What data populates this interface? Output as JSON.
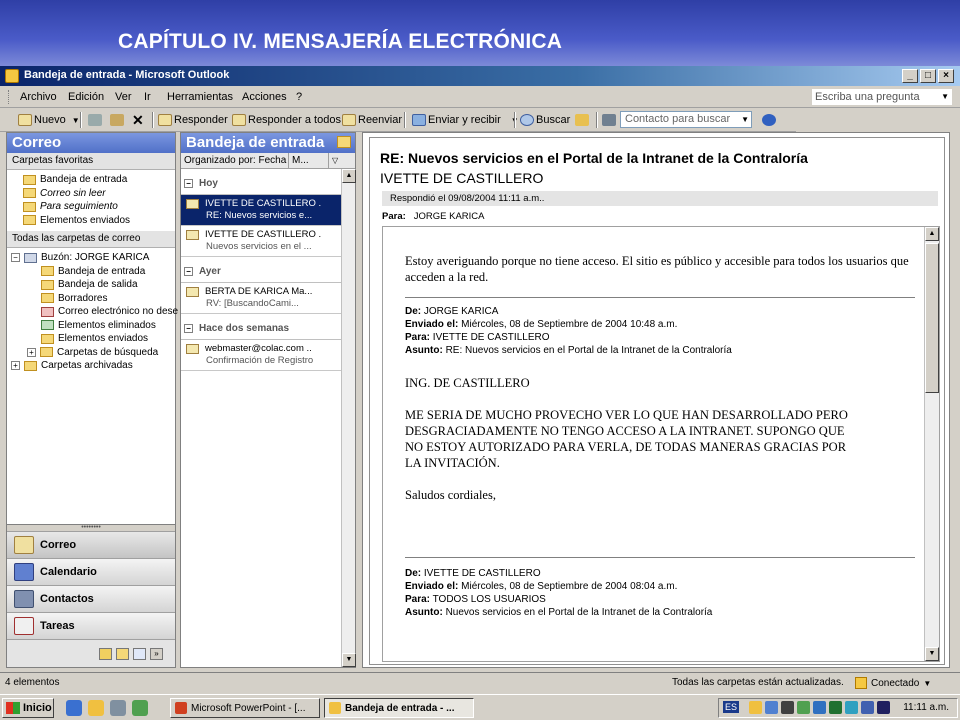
{
  "slide": {
    "title": "CAPÍTULO IV. MENSAJERÍA ELECTRÓNICA"
  },
  "window": {
    "title": "Bandeja de entrada - Microsoft Outlook"
  },
  "menu": {
    "items": [
      "Archivo",
      "Edición",
      "Ver",
      "Ir",
      "Herramientas",
      "Acciones",
      "?"
    ],
    "help_placeholder": "Escriba una pregunta"
  },
  "toolbar": {
    "new": "Nuevo",
    "reply": "Responder",
    "reply_all": "Responder a todos",
    "forward": "Reenviar",
    "send_receive": "Enviar y recibir",
    "find": "Buscar",
    "contact_search": "Contacto para buscar"
  },
  "nav": {
    "title": "Correo",
    "favorites_header": "Carpetas favoritas",
    "favorites": [
      "Bandeja de entrada",
      "Correo sin leer",
      "Para seguimiento",
      "Elementos enviados"
    ],
    "all_header": "Todas las carpetas de correo",
    "mailbox": "Buzón: JORGE KARICA",
    "folders": [
      "Bandeja de entrada",
      "Bandeja de salida",
      "Borradores",
      "Correo electrónico no dese",
      "Elementos eliminados",
      "Elementos enviados",
      "Carpetas de búsqueda"
    ],
    "archive": "Carpetas archivadas",
    "buttons": [
      "Correo",
      "Calendario",
      "Contactos",
      "Tareas"
    ]
  },
  "inbox": {
    "title": "Bandeja de entrada",
    "sort_label": "Organizado por: Fecha",
    "sort_order": "M...",
    "groups": [
      {
        "label": "Hoy",
        "messages": [
          {
            "from": "IVETTE DE CASTILLERO .",
            "preview": "RE: Nuevos servicios e...",
            "selected": true
          },
          {
            "from": "IVETTE DE CASTILLERO .",
            "preview": "Nuevos servicios en el ...",
            "selected": false
          }
        ]
      },
      {
        "label": "Ayer",
        "messages": [
          {
            "from": "BERTA DE KARICA  Ma...",
            "preview": "RV: [BuscandoCami...",
            "selected": false
          }
        ]
      },
      {
        "label": "Hace dos semanas",
        "messages": [
          {
            "from": "webmaster@colac.com ..",
            "preview": "Confirmación de Registro",
            "selected": false
          }
        ]
      }
    ]
  },
  "reading": {
    "subject": "RE: Nuevos servicios en el Portal de la Intranet de la Contraloría",
    "sender": "IVETTE DE CASTILLERO",
    "info": "Respondió el 09/08/2004 11:11 a.m..",
    "to_label": "Para:",
    "to_value": "JORGE KARICA",
    "reply_text": "Estoy averiguando porque no tiene acceso. El sitio es público y accesible para todos los usuarios que acceden a la red.",
    "quoted1": {
      "from_label": "De:",
      "from": "JORGE KARICA",
      "sent_label": "Enviado el:",
      "sent": "Miércoles, 08 de Septiembre de 2004 10:48 a.m.",
      "to_label": "Para:",
      "to": "IVETTE DE CASTILLERO",
      "subject_label": "Asunto:",
      "subject": "RE: Nuevos servicios en el Portal de la Intranet de la Contraloría"
    },
    "greeting": "ING. DE CASTILLERO",
    "message": "ME SERIA DE MUCHO PROVECHO VER LO QUE HAN DESARROLLADO PERO DESGRACIADAMENTE NO TENGO ACCESO A LA INTRANET. SUPONGO QUE NO ESTOY AUTORIZADO PARA VERLA, DE TODAS MANERAS GRACIAS POR LA INVITACIÓN.",
    "closing": "Saludos cordiales,",
    "quoted2": {
      "from_label": "De:",
      "from": "IVETTE DE CASTILLERO",
      "sent_label": "Enviado el:",
      "sent": "Miércoles, 08 de Septiembre de 2004 08:04 a.m.",
      "to_label": "Para:",
      "to": "TODOS LOS USUARIOS",
      "subject_label": "Asunto:",
      "subject": "Nuevos servicios en el Portal de la Intranet de la Contraloría"
    }
  },
  "status": {
    "count": "4 elementos",
    "sync": "Todas las carpetas están actualizadas.",
    "connection": "Conectado"
  },
  "taskbar": {
    "start": "Inicio",
    "tasks": [
      "Microsoft PowerPoint - [...",
      "Bandeja de entrada - ..."
    ],
    "lang": "ES",
    "clock": "11:11 a.m."
  }
}
